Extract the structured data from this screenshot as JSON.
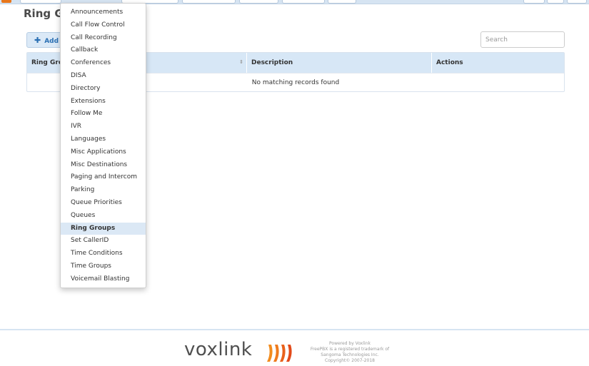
{
  "page": {
    "title": "Ring Gr"
  },
  "toolbar": {
    "add_label": "Add",
    "add_icon": "plus-icon"
  },
  "search": {
    "placeholder": "Search"
  },
  "table": {
    "columns": [
      "Ring Gro",
      "Description",
      "Actions"
    ],
    "empty_message": "No matching records found"
  },
  "menu": {
    "items": [
      "Announcements",
      "Call Flow Control",
      "Call Recording",
      "Callback",
      "Conferences",
      "DISA",
      "Directory",
      "Extensions",
      "Follow Me",
      "IVR",
      "Languages",
      "Misc Applications",
      "Misc Destinations",
      "Paging and Intercom",
      "Parking",
      "Queue Priorities",
      "Queues",
      "Ring Groups",
      "Set CallerID",
      "Time Conditions",
      "Time Groups",
      "Voicemail Blasting"
    ],
    "active": "Ring Groups"
  },
  "footer": {
    "logo_text": "voxlink",
    "lines": [
      "Powered by Voxlink",
      "FreePBX is a registered trademark of",
      "Sangoma Technologies Inc.",
      "Copyright© 2007-2018"
    ]
  },
  "colors": {
    "accent": "#2a6fb3",
    "header_bg": "#d7e7f6",
    "logo_orange": "#f28c1e"
  }
}
